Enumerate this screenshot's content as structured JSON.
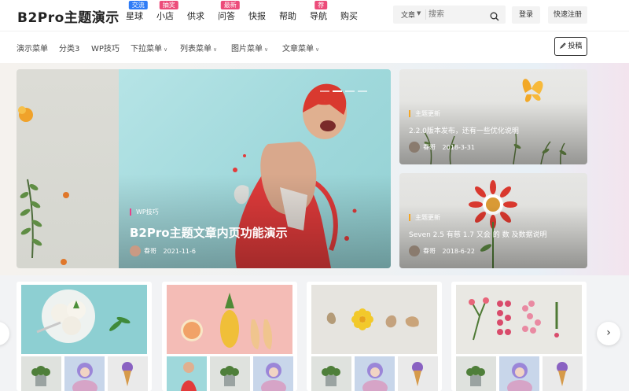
{
  "header": {
    "logo": "B2Pro主题演示",
    "nav": [
      {
        "label": "星球",
        "badge": "交流",
        "badge_color": "#2f7cf6"
      },
      {
        "label": "小店",
        "badge": "抽奖",
        "badge_color": "#ec4c7a"
      },
      {
        "label": "供求",
        "badge": "",
        "badge_color": ""
      },
      {
        "label": "问答",
        "badge": "最新",
        "badge_color": "#ec4c7a"
      },
      {
        "label": "快报",
        "badge": "",
        "badge_color": ""
      },
      {
        "label": "帮助",
        "badge": "",
        "badge_color": ""
      },
      {
        "label": "导航",
        "badge": "荐",
        "badge_color": "#ec4c7a"
      },
      {
        "label": "购买",
        "badge": "",
        "badge_color": ""
      }
    ],
    "search": {
      "category": "文章",
      "placeholder": "搜索"
    },
    "login_label": "登录",
    "register_label": "快速注册"
  },
  "subnav": {
    "items": [
      {
        "label": "演示菜单",
        "dropdown": false
      },
      {
        "label": "分类3",
        "dropdown": false
      },
      {
        "label": "WP技巧",
        "dropdown": false
      },
      {
        "label": "下拉菜单",
        "dropdown": true
      },
      {
        "label": "列表菜单",
        "dropdown": true
      },
      {
        "label": "图片菜单",
        "dropdown": true
      },
      {
        "label": "文章菜单",
        "dropdown": true
      }
    ],
    "post_label": "投稿"
  },
  "hero": {
    "category": "WP技巧",
    "title": "B2Pro主题文章内页功能演示",
    "author": "春哥",
    "date": "2021-11-6"
  },
  "side_cards": [
    {
      "category": "主题更新",
      "title": "2.2.0版本发布，还有一些优化说明",
      "author": "春哥",
      "date": "2018-3-31"
    },
    {
      "category": "主题更新",
      "title": "Seven 2.5 有慈 1.7 又会 的 数 及数据说明",
      "author": "春哥",
      "date": "2018-6-22"
    }
  ],
  "colors": {
    "accent": "#e8408a",
    "update": "#f5a623",
    "hero_bg": "#9fd8db"
  }
}
